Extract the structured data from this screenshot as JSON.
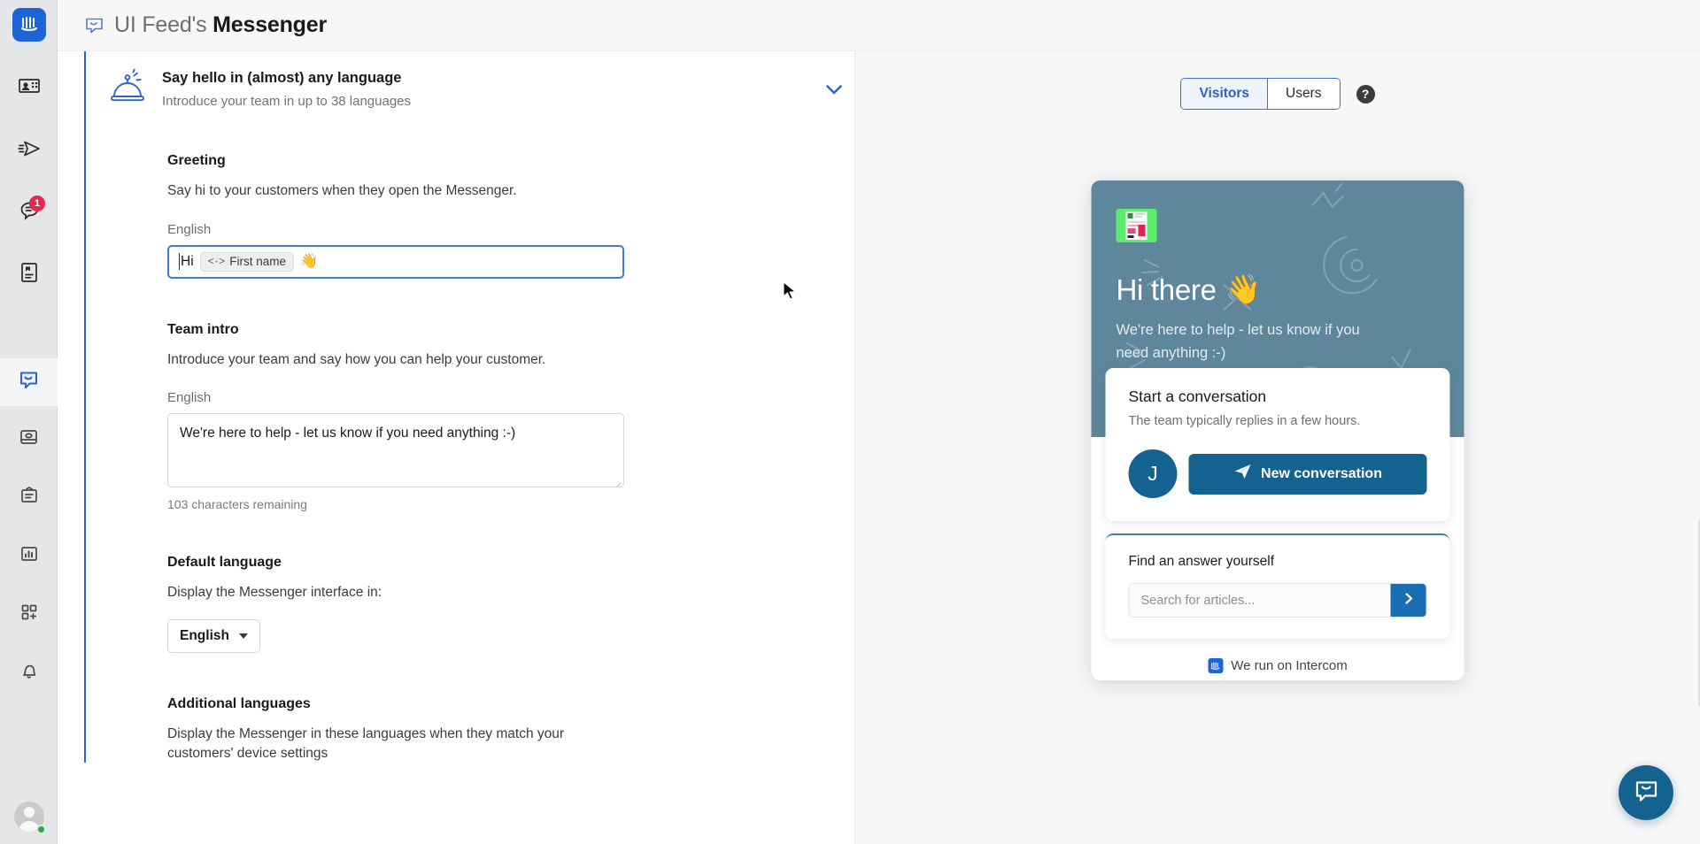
{
  "rail": {
    "logo_name": "intercom-logo",
    "items": [
      {
        "name": "contacts-icon",
        "label": "Contacts",
        "badge": ""
      },
      {
        "name": "outbound-send-icon",
        "label": "Outbound",
        "badge": ""
      },
      {
        "name": "inbox-conversations-icon",
        "label": "Inbox",
        "badge": "1"
      },
      {
        "name": "articles-icon",
        "label": "Articles",
        "badge": ""
      },
      {
        "name": "messenger-icon",
        "label": "Messenger",
        "badge": ""
      },
      {
        "name": "cards-icon",
        "label": "Cards",
        "badge": ""
      },
      {
        "name": "clipboard-icon",
        "label": "Tickets",
        "badge": ""
      },
      {
        "name": "reports-chart-icon",
        "label": "Reports",
        "badge": ""
      },
      {
        "name": "app-store-add-icon",
        "label": "Apps",
        "badge": ""
      },
      {
        "name": "bell-icon",
        "label": "Notifications",
        "badge": ""
      }
    ],
    "avatar_status": "online"
  },
  "topbar": {
    "icon": "messenger-speech-bubble-icon",
    "org": "UI Feed's",
    "app_name": "Messenger"
  },
  "settings": {
    "card": {
      "icon": "service-bell-icon",
      "title": "Say hello in (almost) any language",
      "subtitle": "Introduce your team in up to 38 languages",
      "collapse_icon": "chevron-down-icon"
    },
    "greeting": {
      "title": "Greeting",
      "description": "Say hi to your customers when they open the Messenger.",
      "language_label": "English",
      "value_prefix": "Hi",
      "token_glyph": "<·>",
      "token_label": "First name",
      "emoji": "👋"
    },
    "team_intro": {
      "title": "Team intro",
      "description": "Introduce your team and say how you can help your customer.",
      "language_label": "English",
      "value": "We're here to help - let us know if you need anything :-)",
      "char_count": "103 characters remaining"
    },
    "default_language": {
      "title": "Default language",
      "description": "Display the Messenger interface in:",
      "selected": "English",
      "caret_icon": "caret-down-icon"
    },
    "additional_languages": {
      "title": "Additional languages",
      "description": "Display the Messenger in these languages when they match your customers' device settings"
    }
  },
  "preview": {
    "tabs": [
      {
        "label": "Visitors",
        "active": true
      },
      {
        "label": "Users",
        "active": false
      }
    ],
    "help_icon": "help-question-icon",
    "messenger": {
      "logo_name": "workspace-logo",
      "greeting": "Hi there",
      "greeting_emoji": "👋",
      "intro": "We're here to help - let us know if you need anything :-)",
      "start_card": {
        "title": "Start a conversation",
        "subtitle": "The team typically replies in a few hours.",
        "operator_initial": "J",
        "button_label": "New conversation",
        "button_icon": "paper-plane-icon"
      },
      "help_card": {
        "title": "Find an answer yourself",
        "search_placeholder": "Search for articles...",
        "search_value": "",
        "submit_icon": "chevron-right-icon"
      },
      "footer": {
        "text": "We run on Intercom",
        "logo_name": "intercom-small-logo"
      }
    },
    "fab_icon": "messenger-launcher-icon"
  },
  "colors": {
    "brand_blue": "#1b65d6",
    "accent_blue": "#2d64d4",
    "messenger_header": "#5f879b",
    "messenger_action": "#14628f",
    "badge_red": "#e8274b",
    "online_green": "#27ae43"
  }
}
